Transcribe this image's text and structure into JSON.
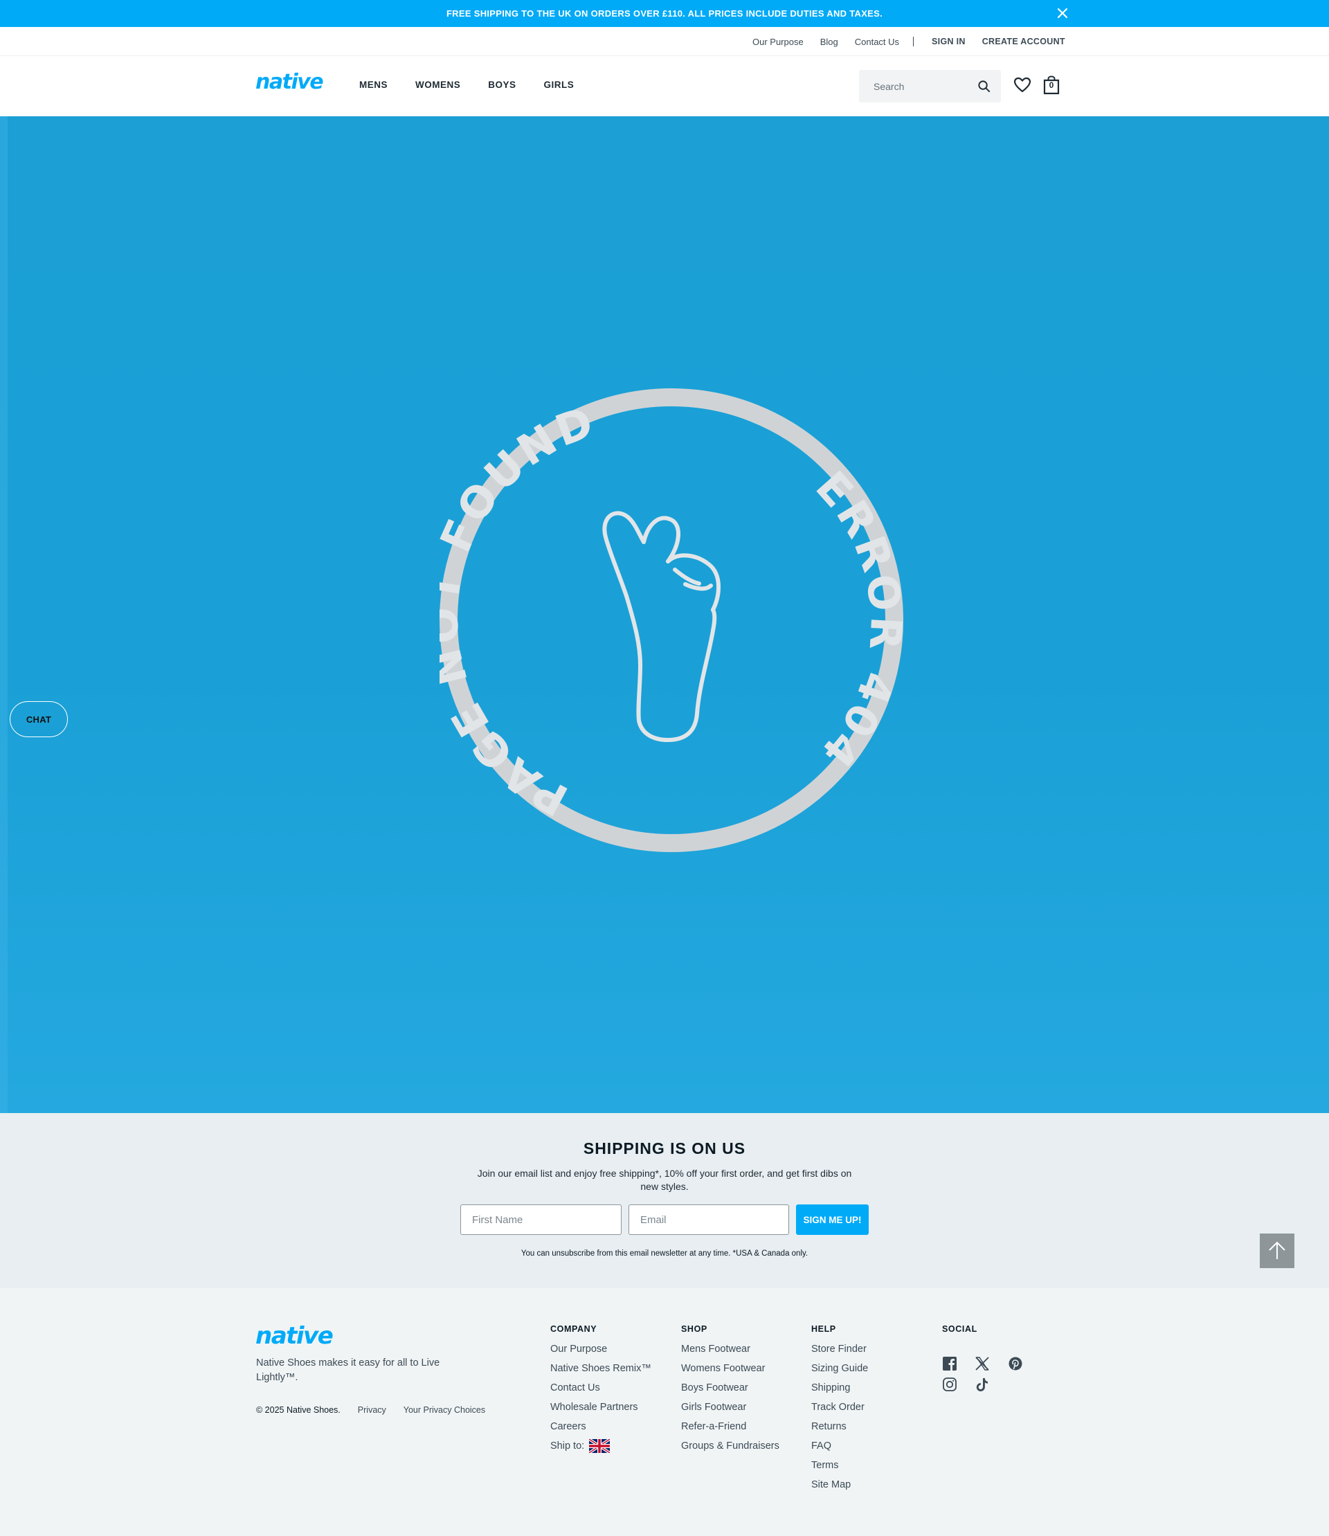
{
  "announcement": {
    "text": "FREE SHIPPING TO THE UK ON ORDERS OVER £110. ALL PRICES INCLUDE DUTIES AND TAXES."
  },
  "utility": {
    "links": [
      "Our Purpose",
      "Blog",
      "Contact Us"
    ],
    "sign_in": "SIGN IN",
    "create_account": "CREATE ACCOUNT"
  },
  "nav": {
    "logo": "native",
    "items": [
      "MENS",
      "WOMENS",
      "BOYS",
      "GIRLS"
    ],
    "search_placeholder": "Search",
    "cart_count": "0"
  },
  "hero": {
    "badge_top_text": "PAGE NOT FOUND",
    "badge_side_text": "ERROR 404",
    "background": "#1aa0d6",
    "badge_color": "#d0d3d6"
  },
  "chat": {
    "label": "CHAT"
  },
  "newsletter": {
    "title": "SHIPPING IS ON US",
    "subtitle": "Join our email list and enjoy free shipping*, 10% off your first order, and get first dibs on new styles.",
    "first_name_placeholder": "First Name",
    "email_placeholder": "Email",
    "button": "SIGN ME UP!",
    "fine_print": "You can unsubscribe from this email newsletter at any time. *USA & Canada only."
  },
  "footer": {
    "logo": "native",
    "tagline": "Native Shoes makes it easy for all to Live Lightly™.",
    "copyright": "© 2025 Native Shoes.",
    "legal": [
      "Privacy",
      "Your Privacy Choices"
    ],
    "company": {
      "title": "COMPANY",
      "links": [
        "Our Purpose",
        "Native Shoes Remix™",
        "Contact Us",
        "Wholesale Partners",
        "Careers"
      ],
      "ship_to": "Ship to:"
    },
    "shop": {
      "title": "SHOP",
      "links": [
        "Mens Footwear",
        "Womens Footwear",
        "Boys Footwear",
        "Girls Footwear",
        "Refer-a-Friend",
        "Groups & Fundraisers"
      ]
    },
    "help": {
      "title": "HELP",
      "links": [
        "Store Finder",
        "Sizing Guide",
        "Shipping",
        "Track Order",
        "Returns",
        "FAQ",
        "Terms",
        "Site Map"
      ]
    },
    "social": {
      "title": "SOCIAL",
      "icons": [
        "facebook-icon",
        "x-icon",
        "pinterest-icon",
        "instagram-icon",
        "tiktok-icon"
      ]
    }
  },
  "colors": {
    "brand": "#00aaf7",
    "hero": "#1aa0d6",
    "newsletter_bg": "#e8eef1",
    "footer_bg": "#f0f4f5"
  }
}
